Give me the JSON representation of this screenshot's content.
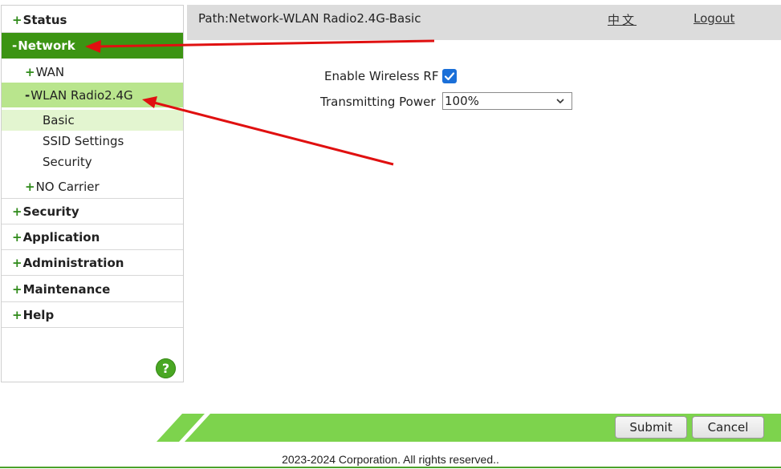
{
  "sidebar": {
    "items": [
      {
        "sign": "+",
        "label": "Status"
      },
      {
        "sign": "-",
        "label": "Network"
      },
      {
        "sign": "+",
        "label": "Security"
      },
      {
        "sign": "+",
        "label": "Application"
      },
      {
        "sign": "+",
        "label": "Administration"
      },
      {
        "sign": "+",
        "label": "Maintenance"
      },
      {
        "sign": "+",
        "label": "Help"
      }
    ],
    "network_sub": [
      {
        "sign": "+",
        "label": "WAN"
      },
      {
        "sign": "-",
        "label": "WLAN Radio2.4G"
      },
      {
        "sign": "+",
        "label": "NO Carrier"
      }
    ],
    "wlan_leaves": [
      "Basic",
      "SSID Settings",
      "Security"
    ],
    "help_icon": "?"
  },
  "header": {
    "path": "Path:Network-WLAN Radio2.4G-Basic",
    "language": "中文",
    "logout": "Logout"
  },
  "form": {
    "enable_rf_label": "Enable Wireless RF",
    "enable_rf_checked": true,
    "tx_power_label": "Transmitting Power",
    "tx_power_value": "100%"
  },
  "footer": {
    "submit": "Submit",
    "cancel": "Cancel",
    "copyright": "2023-2024 Corporation. All rights reserved.."
  },
  "colors": {
    "accent_green": "#3c9413",
    "bar_green": "#7dd34d",
    "highlight_light": "#b9e58d",
    "annotation_red": "#e01010"
  }
}
